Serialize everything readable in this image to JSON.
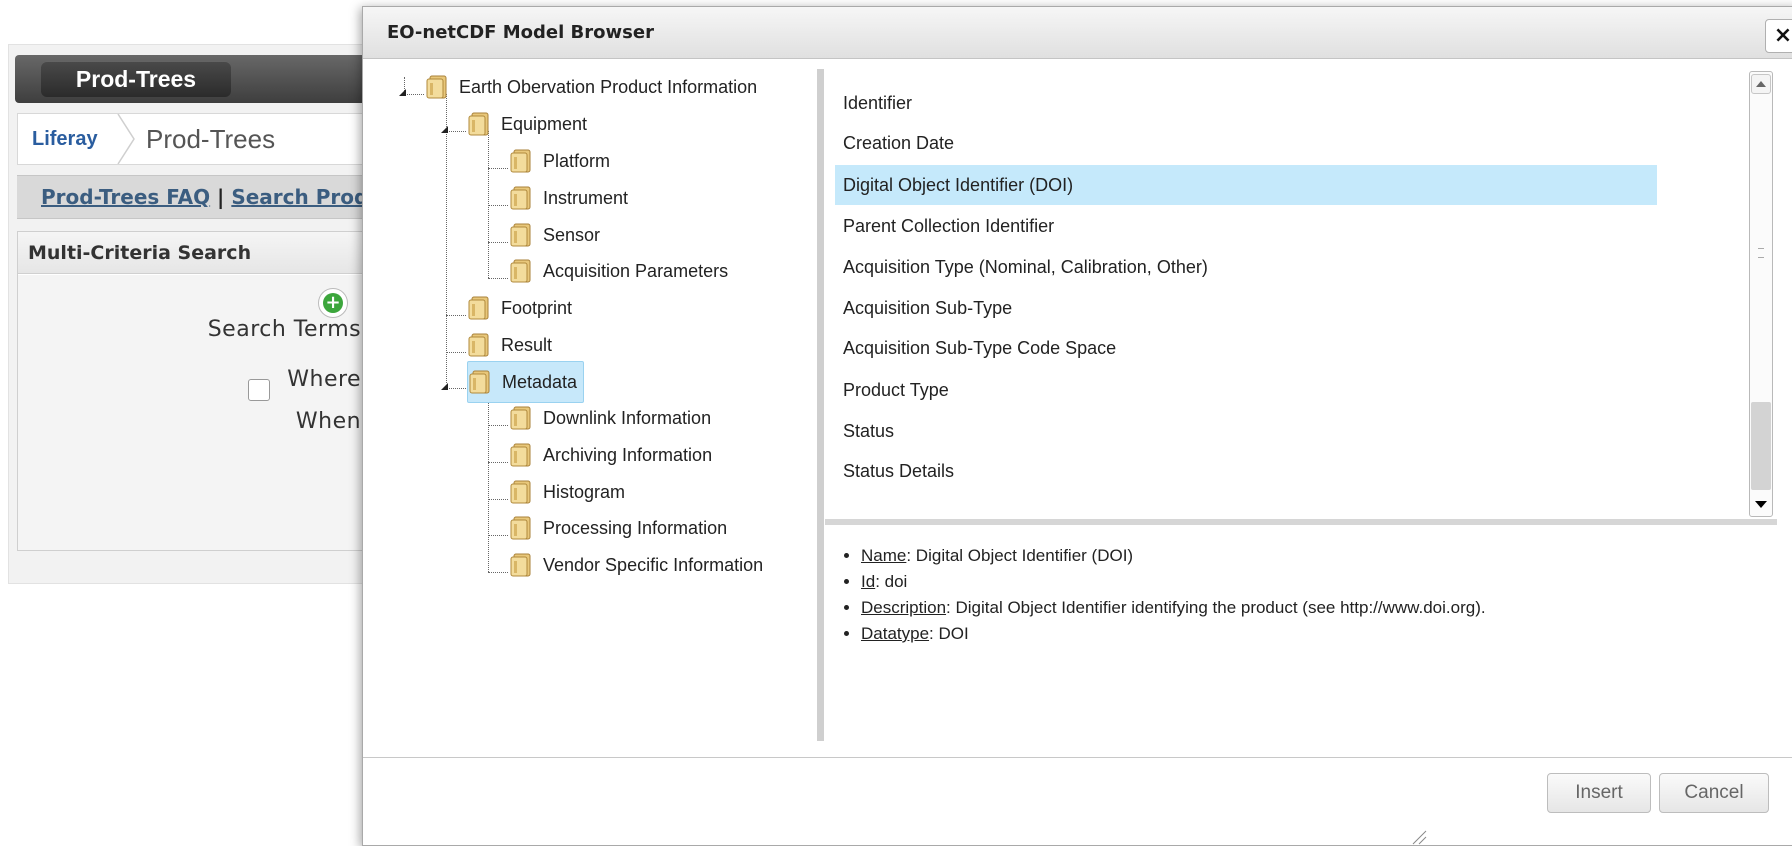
{
  "background": {
    "portlet_title": "Prod-Trees",
    "breadcrumb": {
      "root": "Liferay",
      "current": "Prod-Trees"
    },
    "faq_bar": {
      "faq_link": "Prod-Trees FAQ",
      "separator": " | ",
      "search_link": "Search Prod"
    },
    "search_panel": {
      "title": "Multi-Criteria Search",
      "search_terms_label": "Search Terms:",
      "where_label": "Where:",
      "when_label": "When:",
      "add_icon": "add-circle-icon"
    }
  },
  "dialog": {
    "title": "EO-netCDF Model Browser",
    "close_label": "×",
    "tree": {
      "root": "Earth Obervation Product Information",
      "equipment": "Equipment",
      "platform": "Platform",
      "instrument": "Instrument",
      "sensor": "Sensor",
      "acquisition_parameters": "Acquisition Parameters",
      "footprint": "Footprint",
      "result": "Result",
      "metadata": "Metadata",
      "downlink_information": "Downlink Information",
      "archiving_information": "Archiving Information",
      "histogram": "Histogram",
      "processing_information": "Processing Information",
      "vendor_specific_information": "Vendor Specific Information",
      "selected": "Metadata",
      "folder_icon": "folder-icon"
    },
    "attributes": [
      "Identifier",
      "Creation Date",
      "Digital Object Identifier (DOI)",
      "Parent Collection Identifier",
      "Acquisition Type (Nominal, Calibration, Other)",
      "Acquisition Sub-Type",
      "Acquisition Sub-Type Code Space",
      "Product Type",
      "Status",
      "Status Details"
    ],
    "selected_attribute": "Digital Object Identifier (DOI)",
    "details": {
      "name_key": "Name",
      "name_value": ": Digital Object Identifier (DOI)",
      "id_key": "Id",
      "id_value": ": doi",
      "description_key": "Description",
      "description_value": ": Digital Object Identifier identifying the product (see http://www.doi.org).",
      "datatype_key": "Datatype",
      "datatype_value": ": DOI"
    },
    "buttons": {
      "insert": "Insert",
      "cancel": "Cancel"
    }
  },
  "colors": {
    "selection": "#c5e9fb",
    "link": "#2a5d9f",
    "titlebar_dark": "#3e3e3e"
  }
}
